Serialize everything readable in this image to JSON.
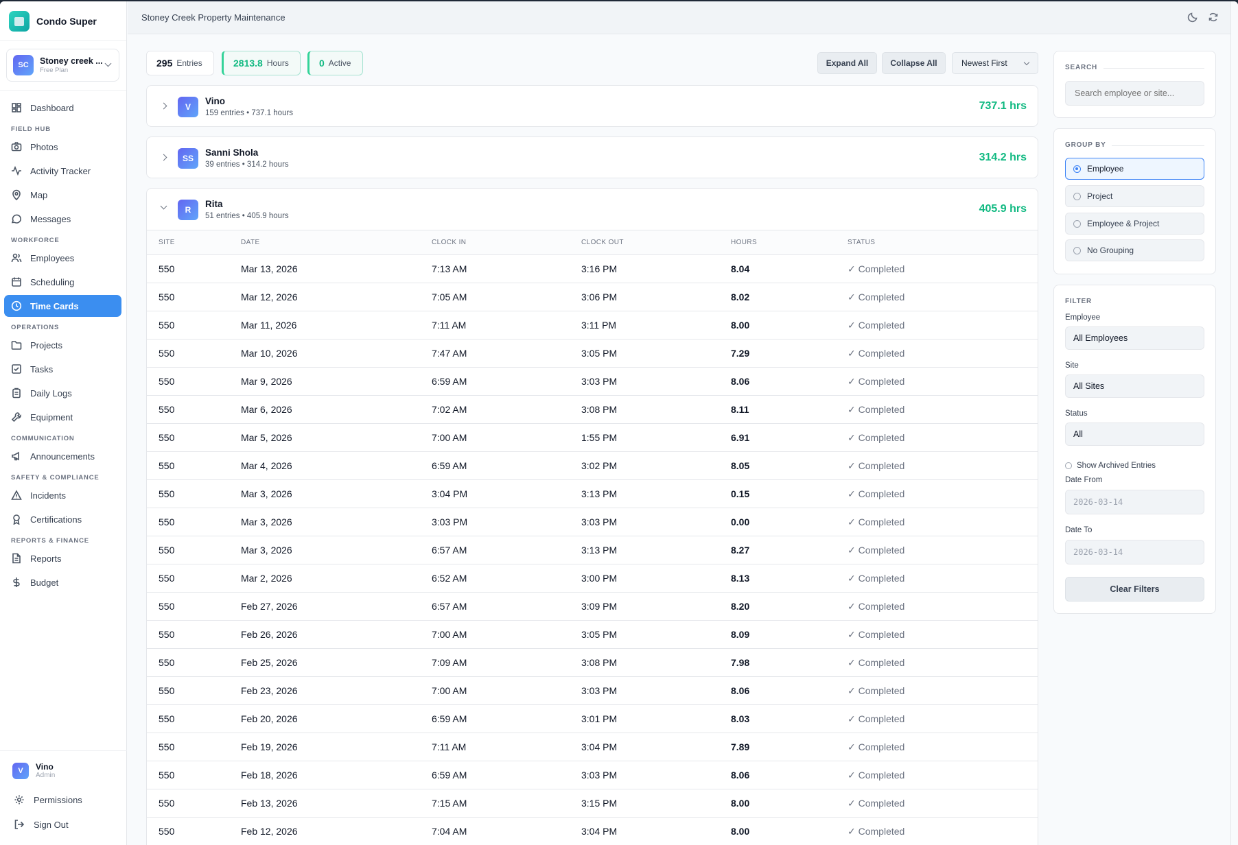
{
  "sidebar": {
    "brand": "Condo Super",
    "org_initials": "SC",
    "org_name": "Stoney creek ...",
    "org_plan": "Free Plan",
    "items": {
      "dashboard": "Dashboard",
      "section_field": "FIELD HUB",
      "photos": "Photos",
      "activity": "Activity Tracker",
      "map": "Map",
      "messages": "Messages",
      "section_workforce": "WORKFORCE",
      "employees": "Employees",
      "scheduling": "Scheduling",
      "timecards": "Time Cards",
      "section_ops": "OPERATIONS",
      "projects": "Projects",
      "tasks": "Tasks",
      "dailylogs": "Daily Logs",
      "equipment": "Equipment",
      "section_comm": "COMMUNICATION",
      "announcements": "Announcements",
      "section_safety": "SAFETY & COMPLIANCE",
      "incidents": "Incidents",
      "certifications": "Certifications",
      "section_reports": "REPORTS & FINANCE",
      "reports": "Reports",
      "budget": "Budget"
    },
    "user_initial": "V",
    "user_name": "Vino",
    "user_role": "Admin",
    "permissions": "Permissions",
    "signout": "Sign Out"
  },
  "header": {
    "title": "Stoney Creek Property Maintenance"
  },
  "stats": {
    "entries_value": "295",
    "entries_label": "Entries",
    "hours_value": "2813.8",
    "hours_label": "Hours",
    "active_value": "0",
    "active_label": "Active"
  },
  "controls": {
    "expand": "Expand All",
    "collapse": "Collapse All",
    "sort": "Newest First"
  },
  "groups": [
    {
      "initials": "V",
      "name": "Vino",
      "meta": "159 entries • 737.1 hours",
      "hours": "737.1 hrs"
    },
    {
      "initials": "SS",
      "name": "Sanni Shola",
      "meta": "39 entries • 314.2 hours",
      "hours": "314.2 hrs"
    },
    {
      "initials": "R",
      "name": "Rita",
      "meta": "51 entries • 405.9 hours",
      "hours": "405.9 hrs"
    }
  ],
  "table": {
    "headers": [
      "SITE",
      "DATE",
      "CLOCK IN",
      "CLOCK OUT",
      "HOURS",
      "STATUS"
    ],
    "rows": [
      [
        "550",
        "Mar 13, 2026",
        "7:13 AM",
        "3:16 PM",
        "8.04",
        "✓ Completed"
      ],
      [
        "550",
        "Mar 12, 2026",
        "7:05 AM",
        "3:06 PM",
        "8.02",
        "✓ Completed"
      ],
      [
        "550",
        "Mar 11, 2026",
        "7:11 AM",
        "3:11 PM",
        "8.00",
        "✓ Completed"
      ],
      [
        "550",
        "Mar 10, 2026",
        "7:47 AM",
        "3:05 PM",
        "7.29",
        "✓ Completed"
      ],
      [
        "550",
        "Mar 9, 2026",
        "6:59 AM",
        "3:03 PM",
        "8.06",
        "✓ Completed"
      ],
      [
        "550",
        "Mar 6, 2026",
        "7:02 AM",
        "3:08 PM",
        "8.11",
        "✓ Completed"
      ],
      [
        "550",
        "Mar 5, 2026",
        "7:00 AM",
        "1:55 PM",
        "6.91",
        "✓ Completed"
      ],
      [
        "550",
        "Mar 4, 2026",
        "6:59 AM",
        "3:02 PM",
        "8.05",
        "✓ Completed"
      ],
      [
        "550",
        "Mar 3, 2026",
        "3:04 PM",
        "3:13 PM",
        "0.15",
        "✓ Completed"
      ],
      [
        "550",
        "Mar 3, 2026",
        "3:03 PM",
        "3:03 PM",
        "0.00",
        "✓ Completed"
      ],
      [
        "550",
        "Mar 3, 2026",
        "6:57 AM",
        "3:13 PM",
        "8.27",
        "✓ Completed"
      ],
      [
        "550",
        "Mar 2, 2026",
        "6:52 AM",
        "3:00 PM",
        "8.13",
        "✓ Completed"
      ],
      [
        "550",
        "Feb 27, 2026",
        "6:57 AM",
        "3:09 PM",
        "8.20",
        "✓ Completed"
      ],
      [
        "550",
        "Feb 26, 2026",
        "7:00 AM",
        "3:05 PM",
        "8.09",
        "✓ Completed"
      ],
      [
        "550",
        "Feb 25, 2026",
        "7:09 AM",
        "3:08 PM",
        "7.98",
        "✓ Completed"
      ],
      [
        "550",
        "Feb 23, 2026",
        "7:00 AM",
        "3:03 PM",
        "8.06",
        "✓ Completed"
      ],
      [
        "550",
        "Feb 20, 2026",
        "6:59 AM",
        "3:01 PM",
        "8.03",
        "✓ Completed"
      ],
      [
        "550",
        "Feb 19, 2026",
        "7:11 AM",
        "3:04 PM",
        "7.89",
        "✓ Completed"
      ],
      [
        "550",
        "Feb 18, 2026",
        "6:59 AM",
        "3:03 PM",
        "8.06",
        "✓ Completed"
      ],
      [
        "550",
        "Feb 13, 2026",
        "7:15 AM",
        "3:15 PM",
        "8.00",
        "✓ Completed"
      ],
      [
        "550",
        "Feb 12, 2026",
        "7:04 AM",
        "3:04 PM",
        "8.00",
        "✓ Completed"
      ]
    ]
  },
  "panel": {
    "search_title": "SEARCH",
    "search_placeholder": "Search employee or site...",
    "group_title": "GROUP BY",
    "group_options": [
      "Employee",
      "Project",
      "Employee & Project",
      "No Grouping"
    ],
    "filter_title": "FILTER",
    "employee_label": "Employee",
    "employee_value": "All Employees",
    "site_label": "Site",
    "site_value": "All Sites",
    "status_label": "Status",
    "status_value": "All",
    "archived_label": "Show Archived Entries",
    "date_from_label": "Date From",
    "date_from_value": "2026-03-14",
    "date_to_label": "Date To",
    "date_to_value": "2026-03-14",
    "clear_label": "Clear Filters"
  }
}
